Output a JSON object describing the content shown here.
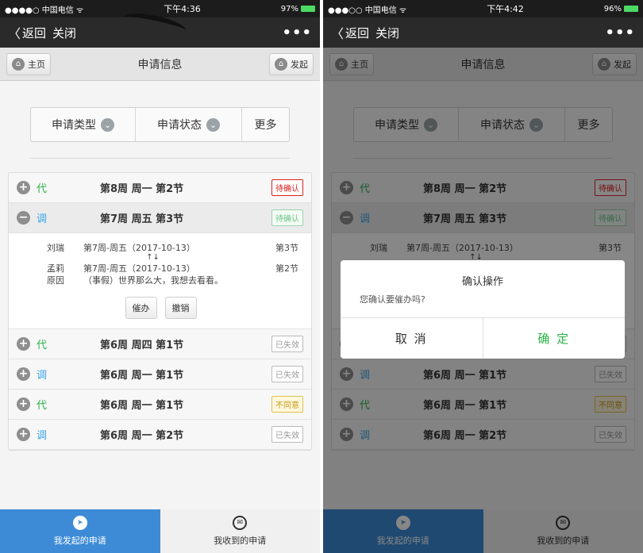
{
  "status": {
    "left_carrier": "●●●●○ 中国电信 ᯤ",
    "left_time": "下午4:36",
    "left_battery": "97%",
    "right_carrier": "●●●○○ 中国电信 ᯤ",
    "right_time": "下午4:42",
    "right_battery": "96%"
  },
  "nav": {
    "back": "返回",
    "close": "关闭",
    "more": "•••",
    "back_icon": "chevron-left-icon"
  },
  "header": {
    "home": "主页",
    "title": "申请信息",
    "launch": "发起"
  },
  "filter": {
    "type": "申请类型",
    "status": "申请状态",
    "more": "更多"
  },
  "list": [
    {
      "kind": "代",
      "title": "第8周 周一 第2节",
      "status": "待确认",
      "style": "red"
    },
    {
      "kind": "调",
      "title": "第7周 周五 第3节",
      "status": "待确认",
      "style": "green"
    },
    {
      "kind": "代",
      "title": "第6周 周四 第1节",
      "status": "已失效",
      "style": "gray"
    },
    {
      "kind": "调",
      "title": "第6周 周一 第1节",
      "status": "已失效",
      "style": "gray"
    },
    {
      "kind": "代",
      "title": "第6周 周一 第1节",
      "status": "不同意",
      "style": "yellow"
    },
    {
      "kind": "调",
      "title": "第6周 周一 第2节",
      "status": "已失效",
      "style": "gray"
    }
  ],
  "detail": {
    "name1": "刘瑞",
    "date1": "第7周-周五（2017-10-13）",
    "sec1": "第3节",
    "arrows": "↑↓",
    "name2": "孟莉",
    "date2": "第7周-周五（2017-10-13）",
    "sec2": "第2节",
    "reason_label": "原因",
    "reason": "（事假）世界那么大，我想去看看。",
    "btn_urge": "催办",
    "btn_cancel": "撤销"
  },
  "tabs": {
    "mine": "我发起的申请",
    "received": "我收到的申请"
  },
  "dialog": {
    "title": "确认操作",
    "message": "您确认要催办吗?",
    "cancel": "取 消",
    "ok": "确 定"
  },
  "colors": {
    "accent": "#3d8bd6",
    "green": "#2cb34a",
    "red": "#e02020"
  }
}
